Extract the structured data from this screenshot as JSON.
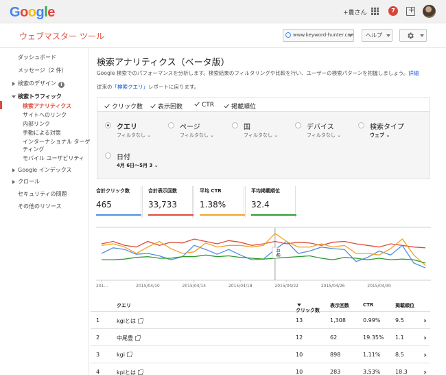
{
  "topbar": {
    "logo_letters": [
      "G",
      "o",
      "o",
      "g",
      "l",
      "e"
    ],
    "user": "+豊さん",
    "notifications": "7"
  },
  "header": {
    "product": "ウェブマスター ツール",
    "site": "www.keyword-hunter.com",
    "help": "ヘルプ"
  },
  "sidebar": {
    "items": [
      {
        "label": "ダッシュボード"
      },
      {
        "label": "メッセージ（2 件）"
      },
      {
        "label": "検索のデザイン"
      },
      {
        "label": "検索トラフィック"
      },
      {
        "label": "検索アナリティクス"
      },
      {
        "label": "サイトへのリンク"
      },
      {
        "label": "内部リンク"
      },
      {
        "label": "手動による対策"
      },
      {
        "label": "インターナショナル ターゲ"
      },
      {
        "label": "ティング"
      },
      {
        "label": "モバイル ユーザビリティ"
      },
      {
        "label": "Google インデックス"
      },
      {
        "label": "クロール"
      },
      {
        "label": "セキュリティの問題"
      },
      {
        "label": "その他のリソース"
      }
    ]
  },
  "main": {
    "title": "検索アナリティクス（ベータ版）",
    "description": "Google 検索でのパフォーマンスを分析します。検索結果のフィルタリングや比較を行い、ユーザーの検索パターンを把握しましょう。",
    "description_link": "詳細",
    "back_prefix": "従来の",
    "back_link": "「検索クエリ」",
    "back_suffix": "レポートに戻ります。",
    "checkboxes": [
      "クリック数",
      "表示回数",
      "CTR",
      "掲載順位"
    ],
    "filters": [
      {
        "label": "クエリ",
        "sub": "フィルタなし",
        "selected": true
      },
      {
        "label": "ページ",
        "sub": "フィルタなし",
        "selected": false
      },
      {
        "label": "国",
        "sub": "フィルタなし",
        "selected": false
      },
      {
        "label": "デバイス",
        "sub": "フィルタなし",
        "selected": false
      },
      {
        "label": "検索タイプ",
        "sub": "ウェブ",
        "selected": false
      },
      {
        "label": "日付",
        "sub": "4月 6日～5月 3",
        "selected": false
      }
    ],
    "metrics": [
      {
        "label": "合計クリック数",
        "value": "465",
        "color": "#4a90e2"
      },
      {
        "label": "合計表示回数",
        "value": "33,733",
        "color": "#dd4b39"
      },
      {
        "label": "平均 CTR",
        "value": "1.38%",
        "color": "#f4a127"
      },
      {
        "label": "平均掲載順位",
        "value": "32.4",
        "color": "#2e9b2e"
      }
    ],
    "table": {
      "headers": [
        "クエリ",
        "クリック数",
        "表示回数",
        "CTR",
        "掲載順位"
      ],
      "rows": [
        {
          "n": "1",
          "query": "kgiとは",
          "clicks": "13",
          "impressions": "1,308",
          "ctr": "0.99%",
          "position": "9.5"
        },
        {
          "n": "2",
          "query": "中尾豊",
          "clicks": "12",
          "impressions": "62",
          "ctr": "19.35%",
          "position": "1.1"
        },
        {
          "n": "3",
          "query": "kgi",
          "clicks": "10",
          "impressions": "898",
          "ctr": "1.11%",
          "position": "8.5"
        },
        {
          "n": "4",
          "query": "kpiとは",
          "clicks": "10",
          "impressions": "283",
          "ctr": "3.53%",
          "position": "18.3"
        }
      ]
    }
  },
  "chart_data": {
    "type": "line",
    "x_tick_labels": [
      "201...",
      "2015/04/10",
      "2015/04/14",
      "2015/04/18",
      "2015/04/22",
      "2015/04/26",
      "2015/04/30"
    ],
    "hover_label": "月曜",
    "series": [
      {
        "color": "#4a90e2",
        "values": [
          30,
          37,
          35,
          29,
          30,
          27,
          22,
          26,
          40,
          35,
          29,
          35,
          28,
          22,
          23,
          35,
          45,
          30,
          33,
          38,
          36,
          35,
          20,
          25,
          33,
          28,
          40,
          18,
          12
        ]
      },
      {
        "color": "#dd4b39",
        "values": [
          42,
          45,
          40,
          38,
          45,
          40,
          44,
          43,
          48,
          45,
          42,
          46,
          44,
          40,
          42,
          45,
          42,
          44,
          43,
          40,
          44,
          45,
          42,
          40,
          38,
          42,
          40,
          38,
          37
        ]
      },
      {
        "color": "#f4a127",
        "values": [
          40,
          42,
          38,
          30,
          38,
          45,
          36,
          30,
          32,
          43,
          38,
          40,
          40,
          38,
          40,
          55,
          45,
          38,
          38,
          42,
          38,
          40,
          30,
          30,
          28,
          36,
          48,
          28,
          15
        ]
      },
      {
        "color": "#2e9b2e",
        "values": [
          22,
          22,
          23,
          25,
          26,
          24,
          24,
          26,
          26,
          28,
          26,
          27,
          25,
          24,
          23,
          24,
          25,
          26,
          27,
          24,
          22,
          25,
          24,
          22,
          24,
          22,
          23,
          22,
          18
        ]
      }
    ]
  }
}
